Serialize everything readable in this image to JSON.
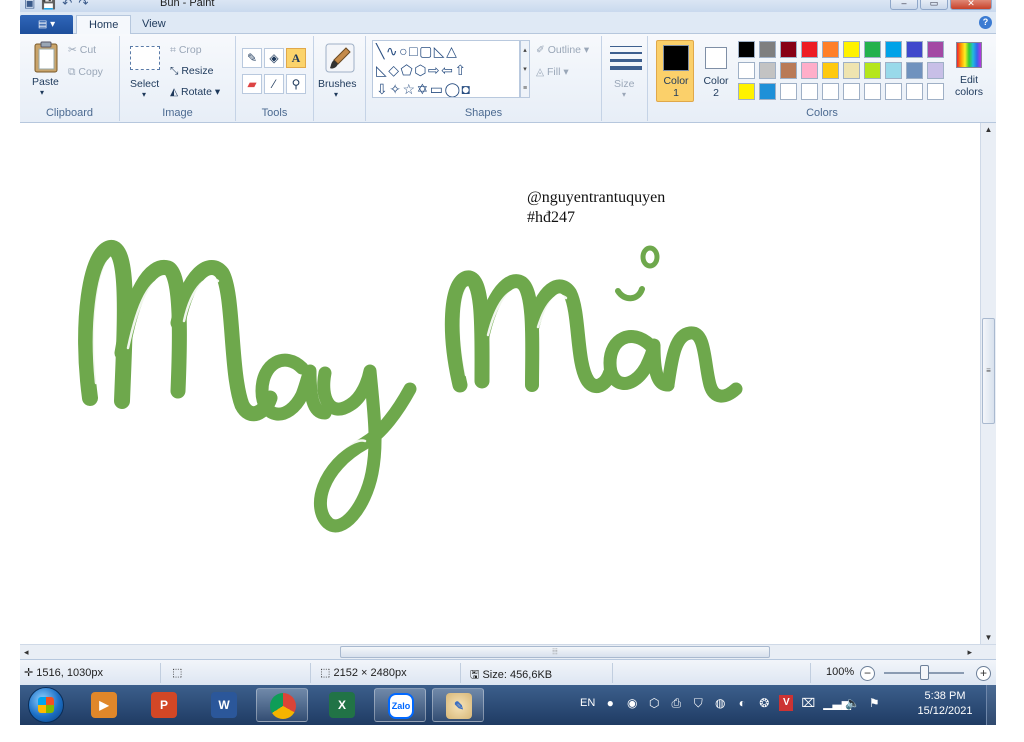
{
  "window": {
    "title": "Bùn - Paint",
    "quick_access": [
      "save-icon",
      "undo-icon",
      "redo-icon",
      "customize-icon"
    ]
  },
  "menu": {
    "file_label": "▤ ▾",
    "tabs": [
      {
        "label": "Home",
        "active": true
      },
      {
        "label": "View",
        "active": false
      }
    ],
    "help": "?"
  },
  "ribbon": {
    "clipboard": {
      "paste": "Paste",
      "cut": "Cut",
      "copy": "Copy",
      "group": "Clipboard"
    },
    "image": {
      "select": "Select",
      "crop": "Crop",
      "resize": "Resize",
      "rotate": "Rotate",
      "group": "Image"
    },
    "tools": {
      "group": "Tools",
      "text_tool": "A"
    },
    "brushes": {
      "label": "Brushes"
    },
    "shapes": {
      "outline": "Outline",
      "fill": "Fill",
      "group": "Shapes"
    },
    "size": {
      "label": "Size"
    },
    "colors": {
      "color1_label": "Color",
      "color1_num": "1",
      "color2_label": "Color",
      "color2_num": "2",
      "color1_value": "#000000",
      "color2_value": "#ffffff",
      "edit_top": "Edit",
      "edit_bottom": "colors",
      "group": "Colors",
      "palette": [
        "#000000",
        "#7f7f7f",
        "#880015",
        "#ed1c24",
        "#ff7f27",
        "#fff200",
        "#22b14c",
        "#00a2e8",
        "#3f48cc",
        "#a349a4",
        "#ffffff",
        "#c3c3c3",
        "#b97a57",
        "#ffaec9",
        "#ffc90e",
        "#efe4b0",
        "#b5e61d",
        "#99d9ea",
        "#7092be",
        "#c8bfe7",
        "#fff200",
        "#1e90d8",
        "#ffffff",
        "#ffffff",
        "#ffffff",
        "#ffffff",
        "#ffffff",
        "#ffffff",
        "#ffffff",
        "#ffffff"
      ]
    }
  },
  "canvas": {
    "handle": "@nguyentrantuquyen",
    "hashtag": "#hđ247",
    "lettering": "May Mắn",
    "lettering_color": "#6ea84c"
  },
  "status": {
    "cursor_pos": "1516, 1030px",
    "image_dims": "2152 × 2480px",
    "file_size": "Size: 456,6KB",
    "zoom": "100%",
    "zoom_level": 0.5
  },
  "taskbar": {
    "apps": [
      "Windows Media Player",
      "PowerPoint",
      "Word",
      "Chrome",
      "Excel",
      "Zalo",
      "Paint"
    ],
    "zalo_label": "Zalo",
    "lang": "EN",
    "time": "5:38 PM",
    "date": "15/12/2021"
  }
}
